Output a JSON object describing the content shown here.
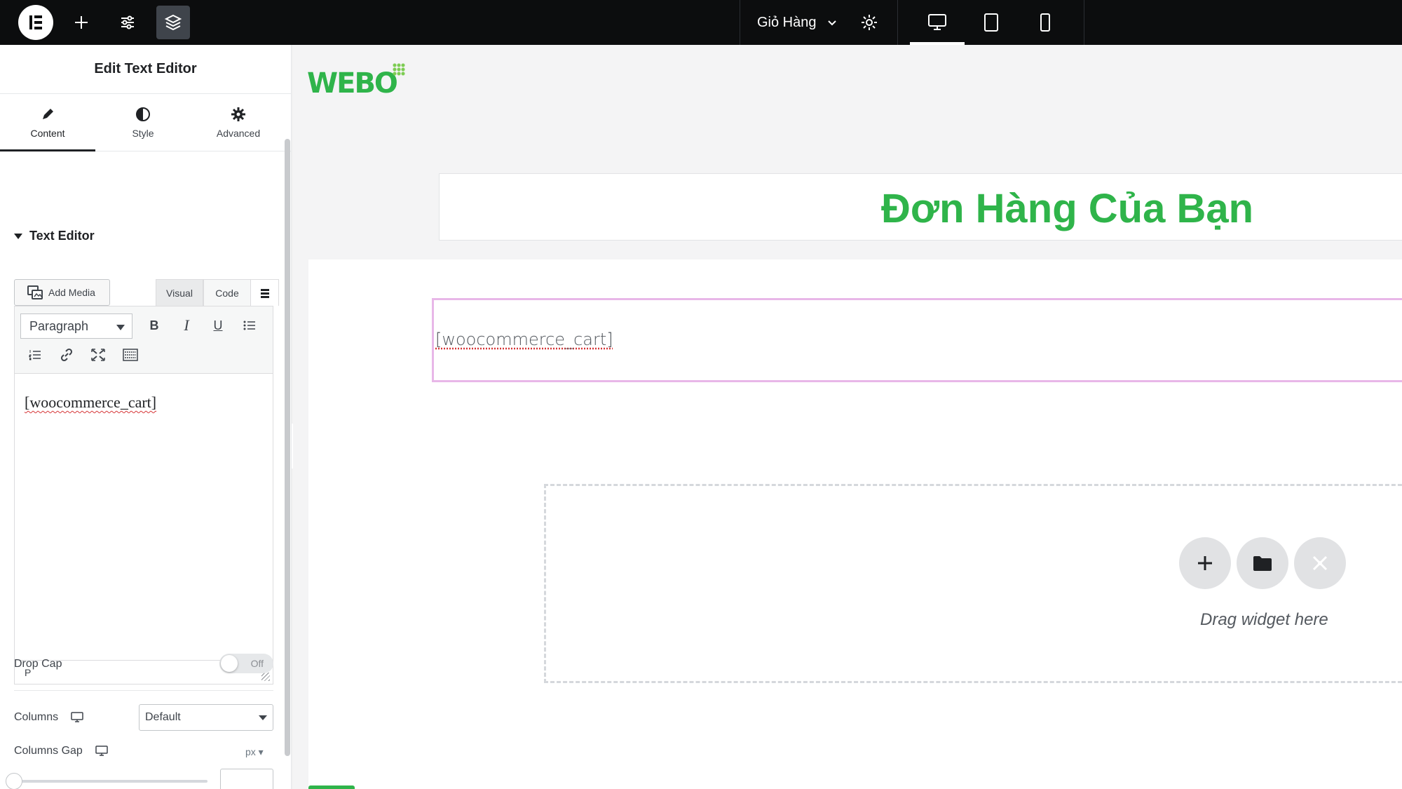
{
  "topbar": {
    "page_name": "Giỏ Hàng",
    "icons": [
      "elementor-logo-icon",
      "plus-icon",
      "sliders-icon",
      "layers-icon",
      "chevron-down-icon",
      "gear-icon",
      "desktop-icon",
      "tablet-icon",
      "mobile-icon"
    ]
  },
  "panel": {
    "title": "Edit Text Editor",
    "tabs": [
      {
        "label": "Content",
        "icon": "pencil-icon"
      },
      {
        "label": "Style",
        "icon": "half-circle-icon"
      },
      {
        "label": "Advanced",
        "icon": "gear-icon"
      }
    ],
    "section_title": "Text Editor",
    "add_media": "Add Media",
    "modes": {
      "visual": "Visual",
      "code": "Code"
    },
    "format": "Paragraph",
    "tools": {
      "bold": "B",
      "italic": "I",
      "underline": "U"
    },
    "content": "[woocommerce_cart]",
    "status_path": "P",
    "drop_cap": {
      "label": "Drop Cap",
      "state": "Off"
    },
    "columns": {
      "label": "Columns",
      "value": "Default"
    },
    "columns_gap": {
      "label": "Columns Gap",
      "unit": "px"
    }
  },
  "canvas": {
    "logo": "WEBO",
    "heading": "Đơn Hàng Của Bạn",
    "shortcode": "[woocommerce_cart]",
    "drop_text": "Drag widget here"
  },
  "colors": {
    "accent_green": "#2fb44a",
    "topbar_bg": "#0c0d0e",
    "selected_outline": "#e8b7e8"
  }
}
